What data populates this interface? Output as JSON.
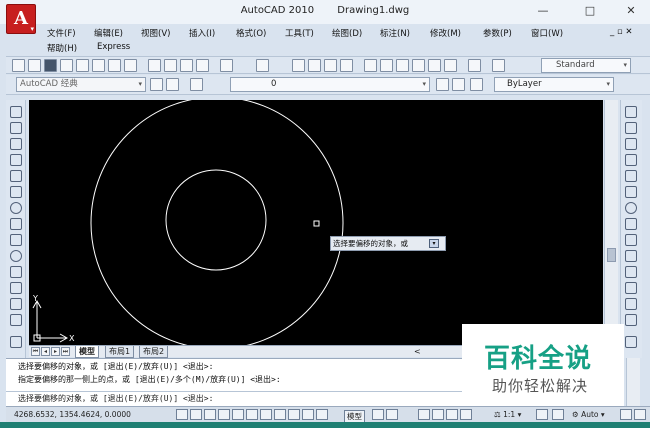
{
  "window": {
    "app_title": "AutoCAD 2010",
    "doc_title": "Drawing1.dwg",
    "logo_letter": "A",
    "minimize_glyph": "—",
    "maximize_glyph": "□",
    "close_glyph": "✕"
  },
  "menu": {
    "items": [
      "文件(F)",
      "编辑(E)",
      "视图(V)",
      "插入(I)",
      "格式(O)",
      "工具(T)",
      "绘图(D)",
      "标注(N)",
      "修改(M)",
      "参数(P)",
      "窗口(W)"
    ],
    "row2": [
      "帮助(H)",
      "Express"
    ],
    "mdi_controls": "_ ▫ ✕"
  },
  "toolbar": {
    "text_style": "Standard",
    "workspace": "AutoCAD 经典",
    "layer": "0",
    "linetype": "ByLayer"
  },
  "canvas": {
    "tooltip_text": "选择要偏移的对象，或",
    "ucs_x": "X",
    "ucs_y": "Y"
  },
  "tabs": {
    "items": [
      "模型",
      "布局1",
      "布局2"
    ],
    "active": "模型"
  },
  "command": {
    "lines": [
      "选择要偏移的对象，或 [退出(E)/放弃(U)] <退出>:",
      "指定要偏移的那一侧上的点，或 [退出(E)/多个(M)/放弃(U)] <退出>:"
    ],
    "prompt": "选择要偏移的对象，或 [退出(E)/放弃(U)] <退出>:"
  },
  "statusbar": {
    "coordinates": "4268.6532, 1354.4624, 0.0000",
    "model_label": "模型",
    "scale": "1:1",
    "auto_label": "Auto"
  },
  "watermark": {
    "title": "百科全说",
    "subtitle": "助你轻松解决"
  },
  "colors": {
    "canvas_bg": "#000000",
    "geometry": "#ffffff",
    "watermark_green": "#16a085",
    "logo_red": "#c71f1f"
  }
}
